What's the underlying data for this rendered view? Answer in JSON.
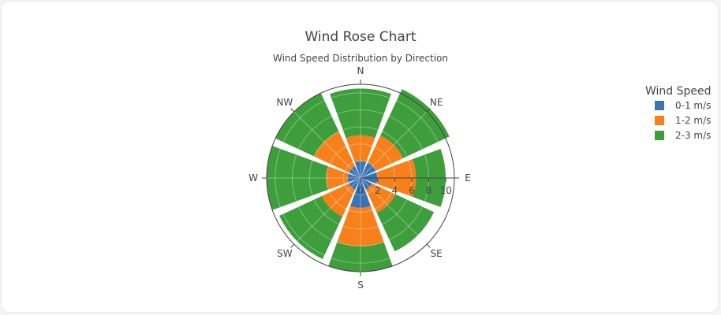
{
  "chart_data": {
    "type": "barpolar",
    "title": "Wind Rose Chart",
    "subtitle": "Wind Speed Distribution by Direction",
    "directions": [
      "N",
      "NE",
      "E",
      "SE",
      "S",
      "SW",
      "W",
      "NW"
    ],
    "radial_range": [
      0,
      11
    ],
    "radial_ticks": [
      0,
      2,
      4,
      6,
      8,
      10
    ],
    "legend_title": "Wind Speed",
    "legend_position": "right",
    "series": [
      {
        "name": "0-1 m/s",
        "color": "#3a74b4",
        "values": [
          2.0,
          2.0,
          2.0,
          1.5,
          3.5,
          1.5,
          1.5,
          1.5
        ]
      },
      {
        "name": "1-2 m/s",
        "color": "#f7801a",
        "values": [
          3.0,
          3.5,
          4.5,
          3.0,
          4.5,
          3.5,
          2.5,
          4.5
        ]
      },
      {
        "name": "2-3 m/s",
        "color": "#3e9e3b",
        "values": [
          5.5,
          6.0,
          3.5,
          5.0,
          3.0,
          5.5,
          7.0,
          5.0
        ]
      }
    ]
  }
}
